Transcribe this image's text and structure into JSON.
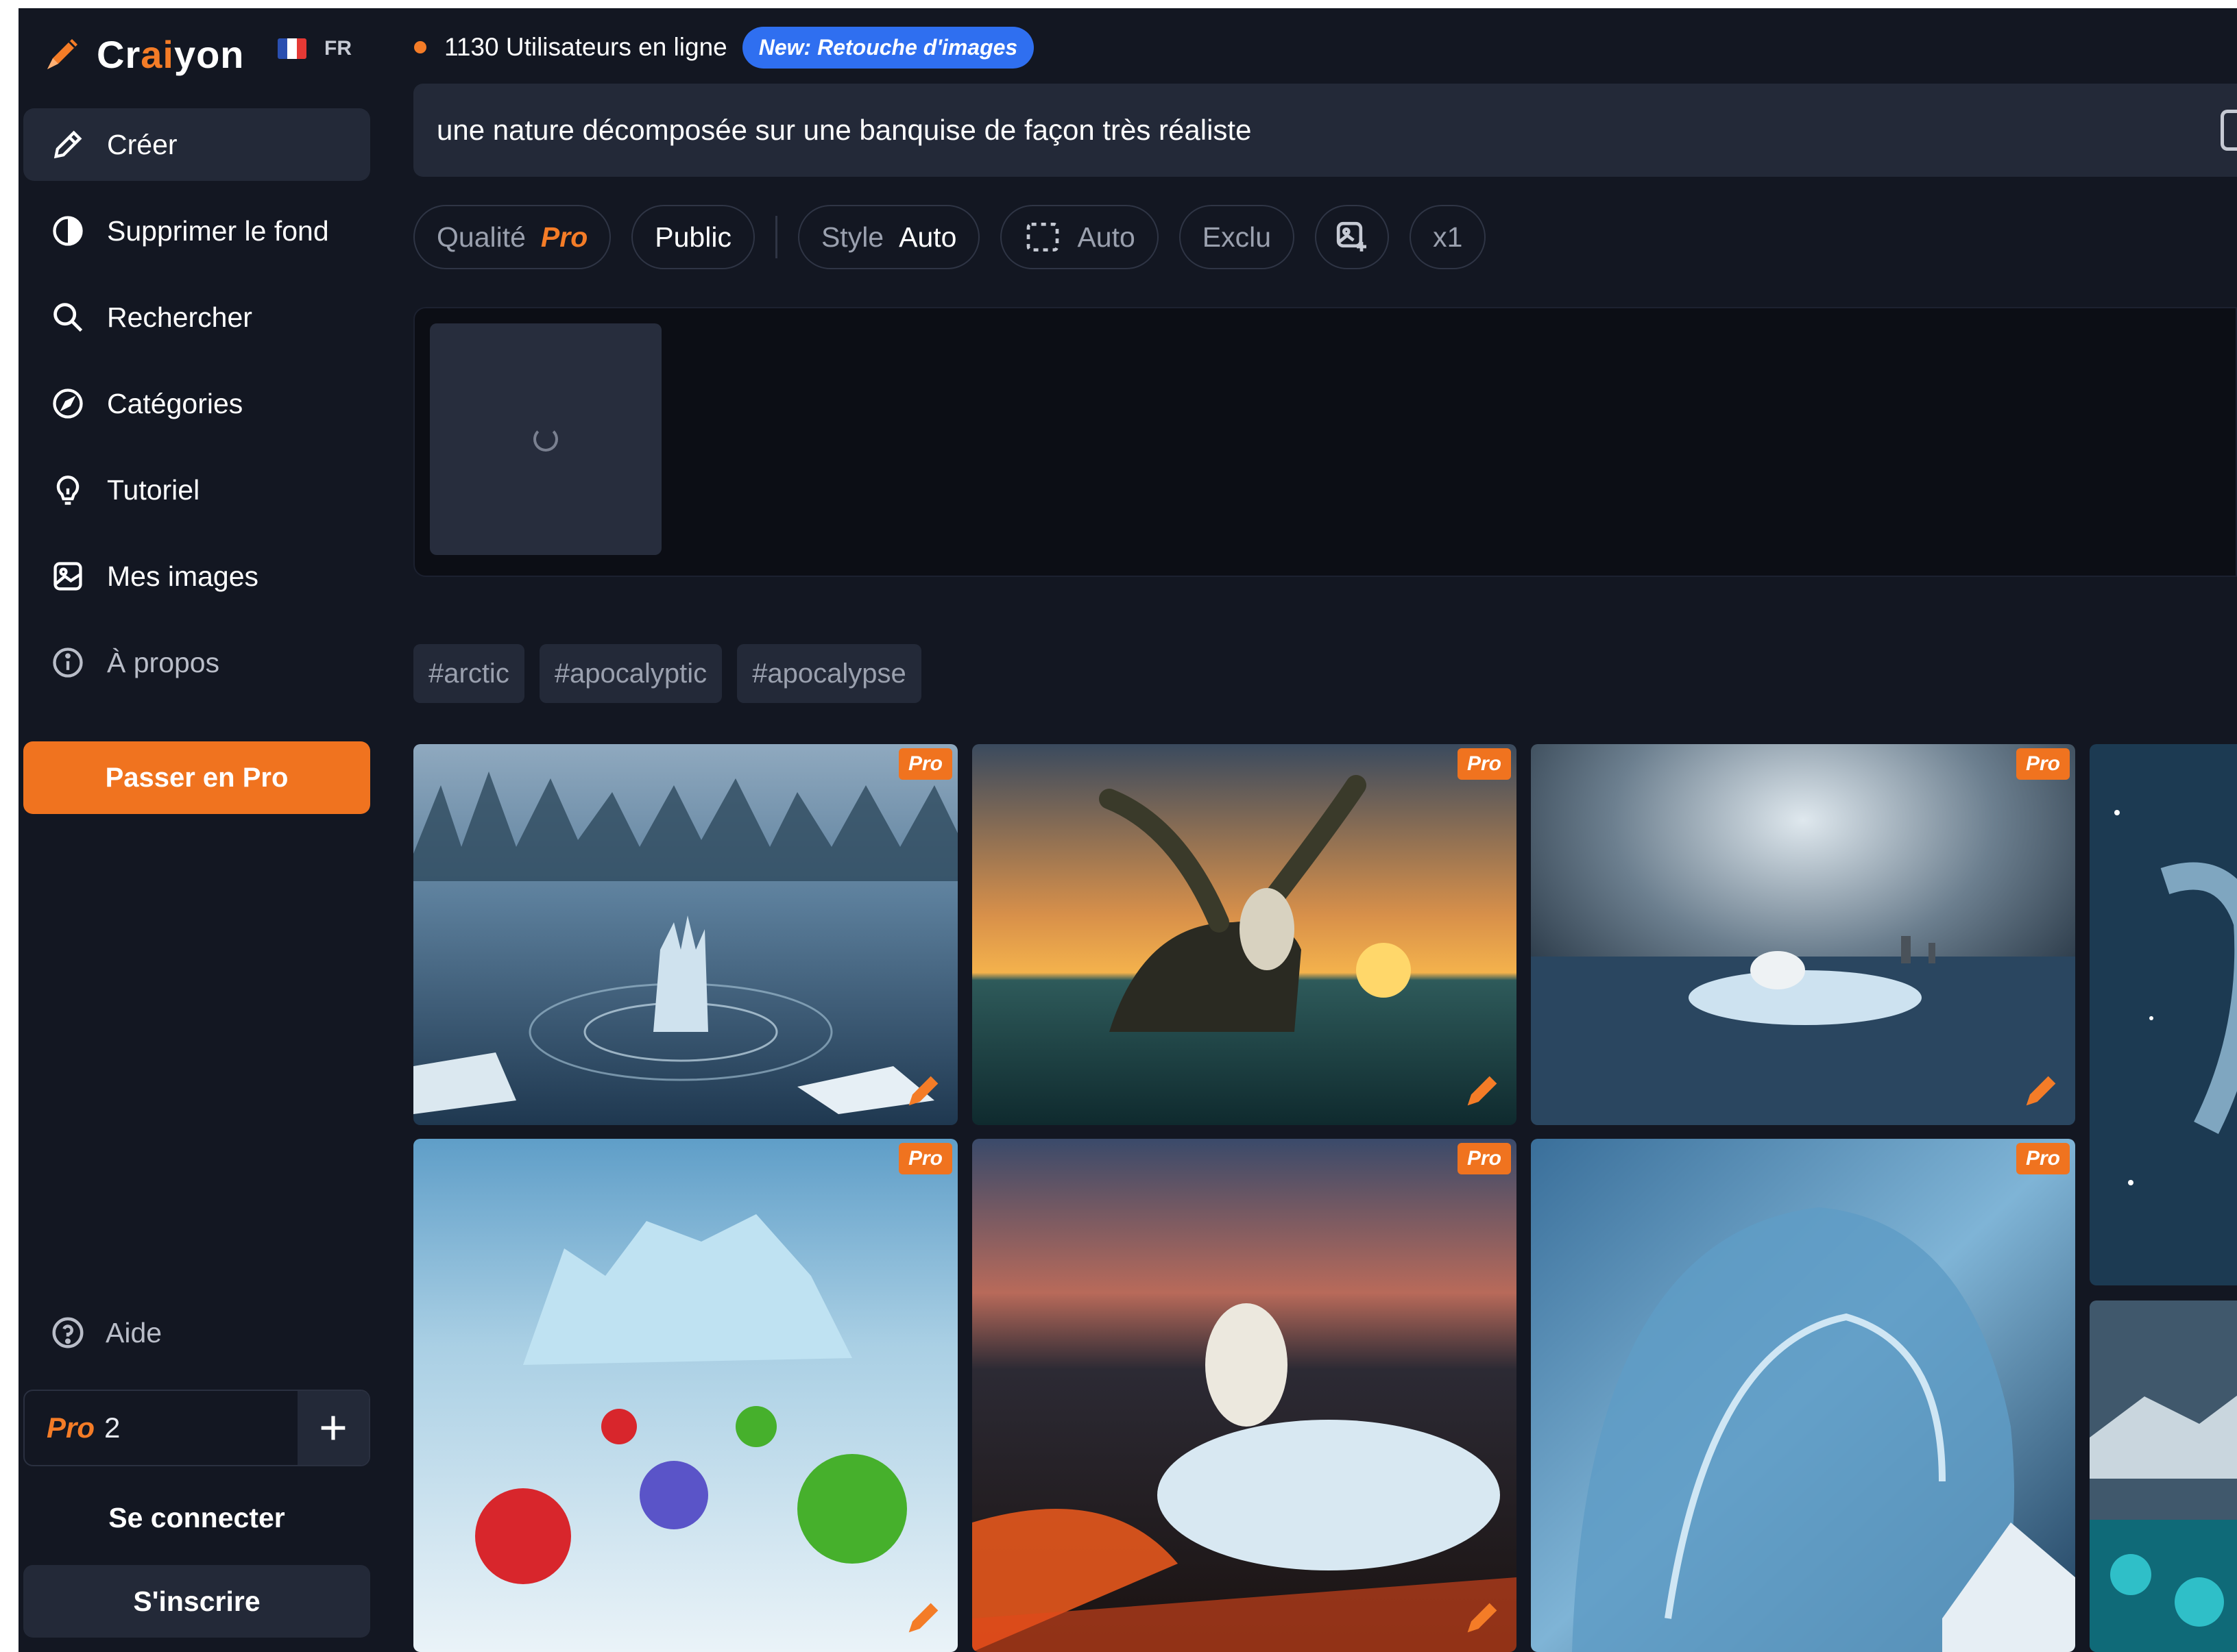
{
  "app": {
    "brand_prefix": "Cr",
    "brand_accent": "ai",
    "brand_suffix": "yon",
    "language": "FR"
  },
  "sidebar": {
    "items": [
      {
        "label": "Créer",
        "icon": "pencil-icon",
        "active": true
      },
      {
        "label": "Supprimer le fond",
        "icon": "contrast-icon"
      },
      {
        "label": "Rechercher",
        "icon": "search-icon"
      },
      {
        "label": "Catégories",
        "icon": "compass-icon"
      },
      {
        "label": "Tutoriel",
        "icon": "lightbulb-icon"
      },
      {
        "label": "Mes images",
        "icon": "image-icon"
      },
      {
        "label": "À propos",
        "icon": "info-icon"
      }
    ],
    "upgrade_label": "Passer en Pro",
    "help_label": "Aide",
    "credits": {
      "plan": "Pro",
      "count": "2"
    },
    "login_label": "Se connecter",
    "signup_label": "S'inscrire"
  },
  "header": {
    "online_text": "1130 Utilisateurs en ligne",
    "new_badge": "New: Retouche d'images"
  },
  "prompt": {
    "value": "une nature décomposée sur une banquise de façon très réaliste"
  },
  "options": {
    "quality_label": "Qualité",
    "quality_value": "Pro",
    "visibility": "Public",
    "style_label": "Style",
    "style_value": "Auto",
    "ratio_value": "Auto",
    "exclude_label": "Exclu",
    "count_label": "x1"
  },
  "tags": [
    "#arctic",
    "#apocalyptic",
    "#apocalypse"
  ],
  "gallery": {
    "pro_badge": "Pro"
  },
  "colors": {
    "accent": "#f0731f",
    "background": "#131722",
    "panel": "#232938",
    "badge_blue": "#2f6ff0"
  }
}
